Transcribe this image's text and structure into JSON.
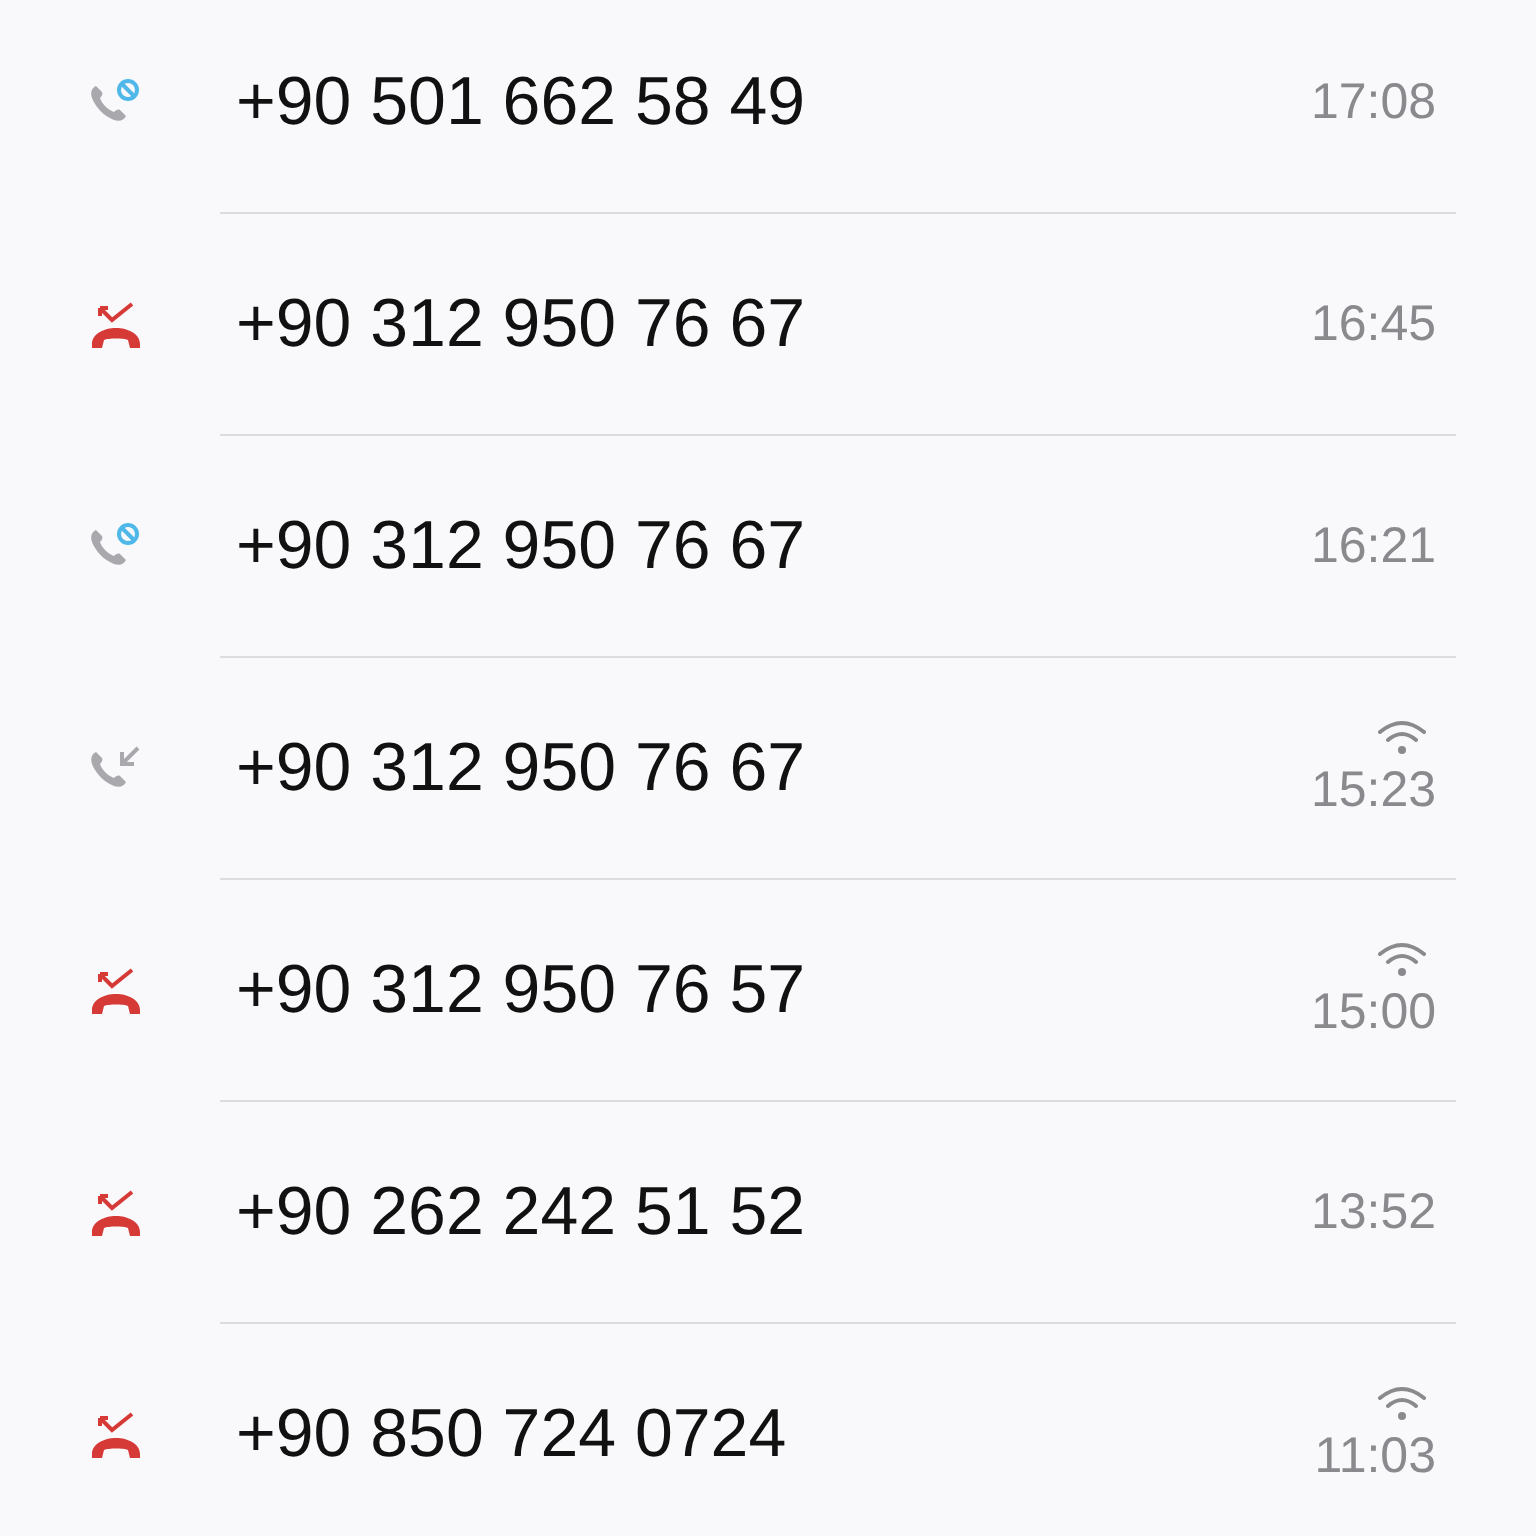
{
  "calls": [
    {
      "kind": "blocked",
      "number": "+90 501 662 58 49",
      "time": "17:08",
      "wifi": false
    },
    {
      "kind": "missed",
      "number": "+90 312 950 76 67",
      "time": "16:45",
      "wifi": false
    },
    {
      "kind": "blocked",
      "number": "+90 312 950 76 67",
      "time": "16:21",
      "wifi": false
    },
    {
      "kind": "incoming",
      "number": "+90 312 950 76 67",
      "time": "15:23",
      "wifi": true
    },
    {
      "kind": "missed",
      "number": "+90 312 950 76 57",
      "time": "15:00",
      "wifi": true
    },
    {
      "kind": "missed",
      "number": "+90 262 242 51 52",
      "time": "13:52",
      "wifi": false
    },
    {
      "kind": "missed",
      "number": "+90 850 724 0724",
      "time": "11:03",
      "wifi": true
    }
  ]
}
